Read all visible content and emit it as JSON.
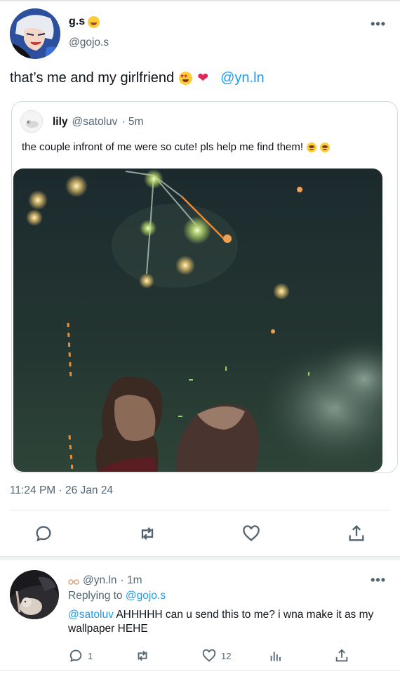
{
  "tweet": {
    "display_name": "g.s",
    "handle": "@gojo.s",
    "more_label": "•••",
    "text": "that’s me and my girlfriend",
    "mention": "@yn.ln",
    "timestamp": "11:24 PM · 26 Jan 24"
  },
  "quote": {
    "name": "lily",
    "handle": "@satoluv",
    "time": "· 5m",
    "text": "the couple infront of me were so cute! pls help me find them!"
  },
  "actions": {
    "reply_icon": "speech-bubble-icon",
    "retweet_icon": "retweet-icon",
    "like_icon": "heart-icon",
    "share_icon": "share-icon"
  },
  "reply": {
    "handle": "@yn.ln",
    "time": "· 1m",
    "more_label": "•••",
    "replying_prefix": "Replying to",
    "replying_to": "@gojo.s",
    "mention": "@satoluv",
    "text": "AHHHHH can u send this to me? i wna make it as my wallpaper HEHE",
    "reply_count": "1",
    "like_count": "12"
  },
  "colors": {
    "accent": "#1d9bf0",
    "secondary_text": "#536471",
    "heart": "#e0245e"
  }
}
